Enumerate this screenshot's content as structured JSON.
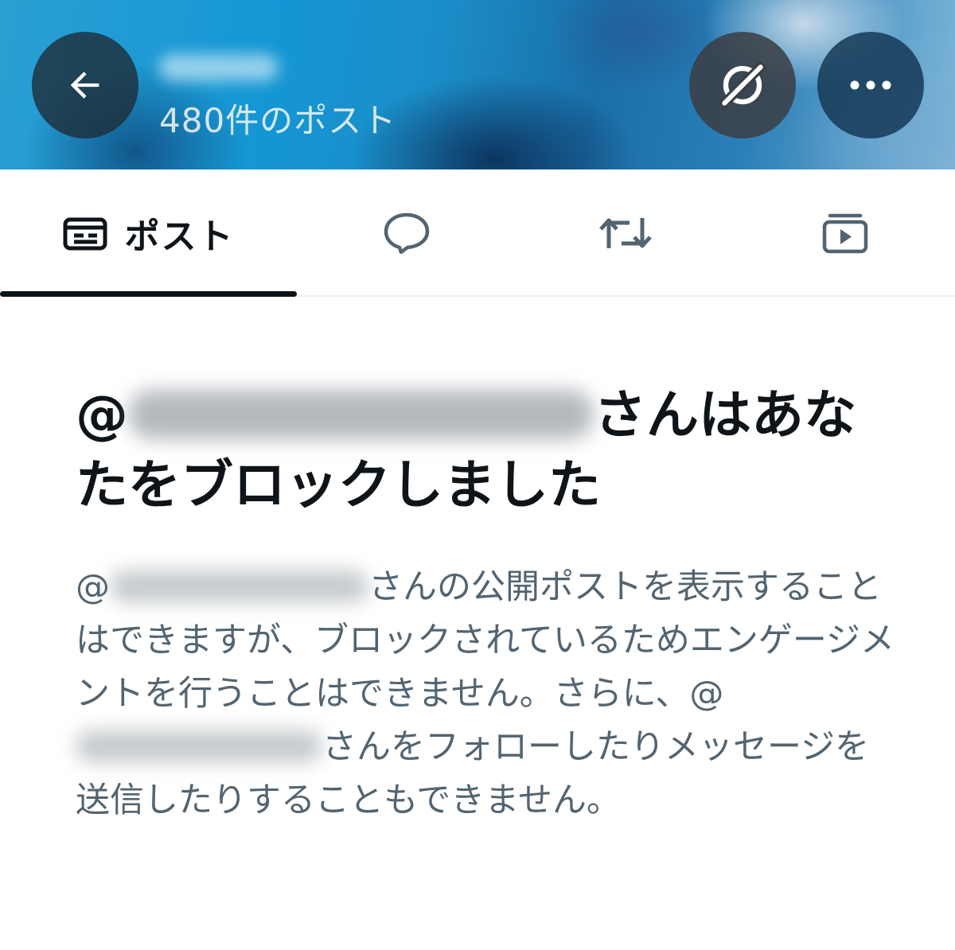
{
  "header": {
    "post_count": "480件のポスト",
    "icons": {
      "back": "arrow-left-icon",
      "grok": "grok-icon",
      "more": "more-dots-icon"
    }
  },
  "tabs": [
    {
      "label": "ポスト",
      "icon": "posts-icon",
      "selected": true
    },
    {
      "label": "",
      "icon": "replies-bubble-icon",
      "selected": false
    },
    {
      "label": "",
      "icon": "repost-icon",
      "selected": false
    },
    {
      "label": "",
      "icon": "media-play-icon",
      "selected": false
    }
  ],
  "notice": {
    "title_prefix": "@",
    "title_suffix": "さんはあなたをブロックしました",
    "desc_prefix_1": "@",
    "desc_part_1": "さんの公開ポストを表示することはできますが、ブロックされているためエンゲージメントを行うことはできません。さらに、@",
    "desc_part_2": "さんをフォローしたりメッセージを送信したりすることもできません。"
  },
  "colors": {
    "text_primary": "#0f1419",
    "text_secondary": "#536471",
    "divider": "#eff3f4",
    "button_overlay": "#1e2a34"
  }
}
